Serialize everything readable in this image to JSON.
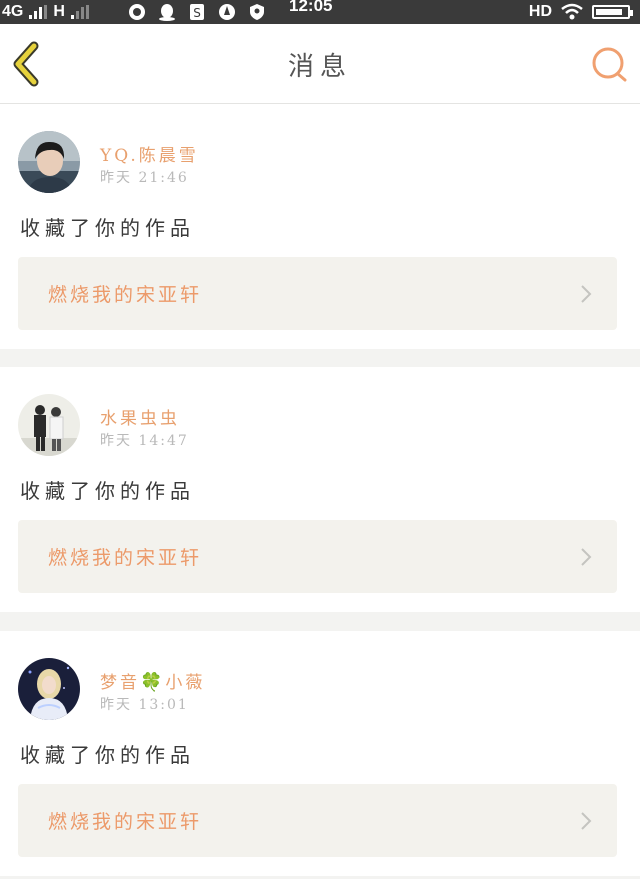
{
  "status_bar": {
    "network_left": "4G",
    "network_right": "H",
    "time": "12:05",
    "hd_label": "HD",
    "battery_level": 0.85
  },
  "header": {
    "title": "消息",
    "back_icon": "chevron-left-icon",
    "search_icon": "search-icon"
  },
  "messages": [
    {
      "user": "YQ.陈晨雪",
      "time": "昨天 21:46",
      "action": "收藏了你的作品",
      "work_title": "燃烧我的宋亚轩"
    },
    {
      "user": "水果虫虫",
      "time": "昨天 14:47",
      "action": "收藏了你的作品",
      "work_title": "燃烧我的宋亚轩"
    },
    {
      "user_prefix": "梦音",
      "user_emoji": "🍀",
      "user_suffix": "小薇",
      "time": "昨天 13:01",
      "action": "收藏了你的作品",
      "work_title": "燃烧我的宋亚轩"
    }
  ],
  "colors": {
    "accent": "#e8a06e",
    "back_arrow": "#d8c23a",
    "card_link_bg": "#f3f2ed"
  }
}
